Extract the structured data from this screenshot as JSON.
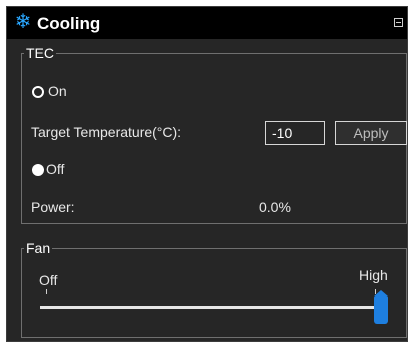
{
  "window": {
    "title": "Cooling",
    "title_icon": "snowflake-icon"
  },
  "tec": {
    "legend": "TEC",
    "mode_options": [
      {
        "label": "On",
        "selected": false
      },
      {
        "label": "Off",
        "selected": true
      }
    ],
    "target_label": "Target Temperature(°C):",
    "target_value": "-10",
    "apply_label": "Apply",
    "power_label": "Power:",
    "power_value": "0.0%"
  },
  "fan": {
    "legend": "Fan",
    "min_label": "Off",
    "max_label": "High",
    "level": 1.0
  },
  "colors": {
    "background": "#262626",
    "titlebar": "#000000",
    "accent": "#1e7fe0"
  }
}
